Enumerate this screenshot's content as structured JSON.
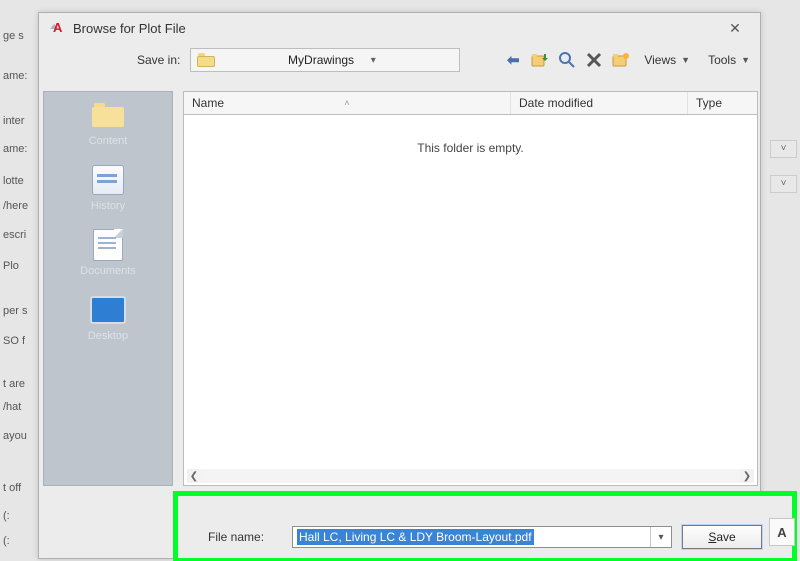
{
  "bg": {
    "labels": [
      "ge s",
      "ame:",
      "inter",
      "ame:",
      "lotte",
      "/here",
      "escri",
      "Plo",
      "per s",
      "SO f",
      "t are",
      "/hat",
      "ayou",
      "t off",
      "(:",
      "(:"
    ]
  },
  "dialog": {
    "title": "Browse for Plot File",
    "close_glyph": "✕"
  },
  "toolbar": {
    "save_in_label": "Save in:",
    "folder_name": "MyDrawings",
    "views_label": "Views",
    "tools_label": "Tools"
  },
  "places": [
    {
      "label": "Content"
    },
    {
      "label": "History"
    },
    {
      "label": "Documents"
    },
    {
      "label": "Desktop"
    }
  ],
  "columns": {
    "name": "Name",
    "date": "Date modified",
    "type": "Type"
  },
  "filelist": {
    "empty_msg": "This folder is empty."
  },
  "bottom": {
    "file_name_label": "File name:",
    "file_name_value": "Hall LC, Living LC & LDY Broom-Layout.pdf",
    "save_s": "S",
    "save_rest": "ave"
  },
  "a_tab": "A"
}
